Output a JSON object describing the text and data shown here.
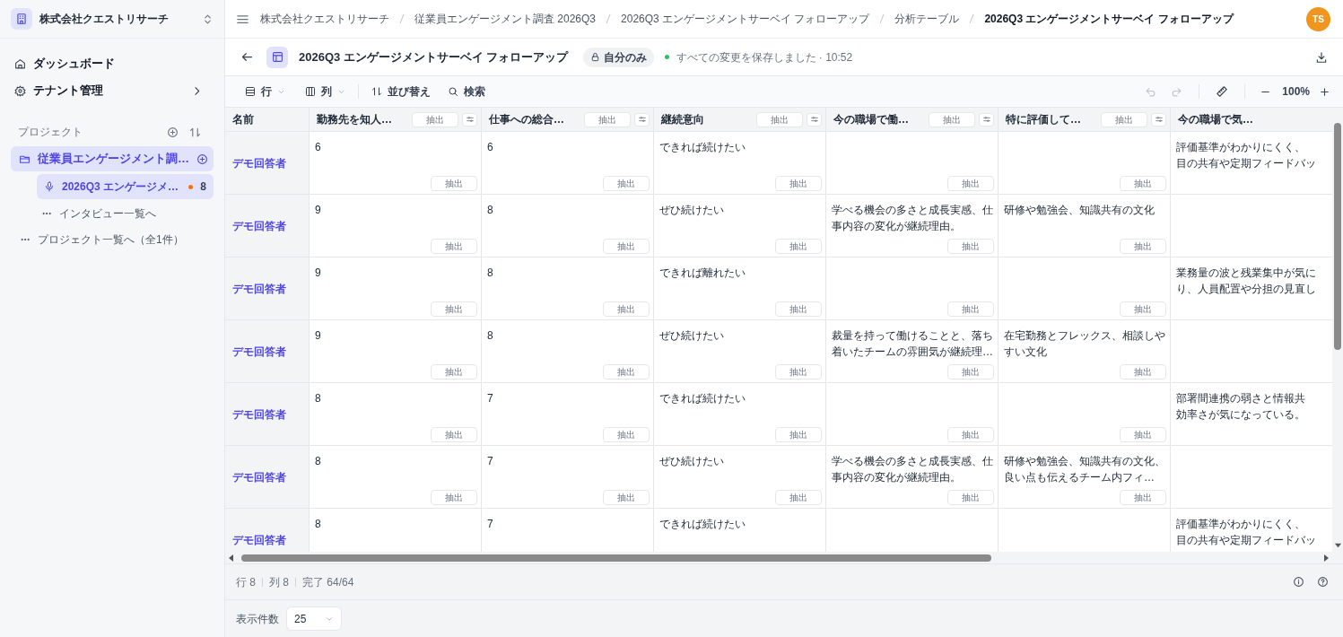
{
  "sidebar": {
    "org": "株式会社クエストリサーチ",
    "nav": [
      {
        "label": "ダッシュボード",
        "kind": "home",
        "has_submenu": false
      },
      {
        "label": "テナント管理",
        "kind": "settings",
        "has_submenu": true
      }
    ],
    "section_title": "プロジェクト",
    "projects": [
      {
        "label": "従業員エンゲージメント調…",
        "selected": true,
        "children": [
          {
            "label": "2026Q3 エンゲージメ…",
            "selected": true,
            "badge": "8"
          }
        ],
        "more_link": "インタビュー一覧へ"
      }
    ],
    "all_projects_link": "プロジェクト一覧へ（全1件）"
  },
  "breadcrumbs": [
    "株式会社クエストリサーチ",
    "従業員エンゲージメント調査 2026Q3",
    "2026Q3 エンゲージメントサーベイ フォローアップ",
    "分析テーブル",
    "2026Q3 エンゲージメントサーベイ フォローアップ"
  ],
  "avatar": "TS",
  "title_bar": {
    "title": "2026Q3 エンゲージメントサーベイ フォローアップ",
    "visibility": "自分のみ",
    "save_status": "すべての変更を保存しました · 10:52"
  },
  "toolbar": {
    "rows": "行",
    "columns": "列",
    "sort": "並び替え",
    "search": "検索",
    "zoom": "100%"
  },
  "table": {
    "name_header": "名前",
    "columns": [
      {
        "label": "勤務先を知人…",
        "action": "抽出"
      },
      {
        "label": "仕事への総合…",
        "action": "抽出"
      },
      {
        "label": "継続意向",
        "action": "抽出"
      },
      {
        "label": "今の職場で働…",
        "action": "抽出"
      },
      {
        "label": "特に評価して…",
        "action": "抽出"
      },
      {
        "label": "今の職場で気…"
      }
    ],
    "rows": [
      {
        "name": "デモ回答者",
        "cells": [
          {
            "text": "6",
            "action": "抽出"
          },
          {
            "text": "6",
            "action": "抽出"
          },
          {
            "text": "できれば続けたい",
            "action": "抽出"
          },
          {
            "action": "抽出"
          },
          {
            "action": "抽出"
          },
          {
            "lines": [
              "評価基準がわかりにくく、",
              "目の共有や定期フィードバッ"
            ]
          }
        ]
      },
      {
        "name": "デモ回答者",
        "cells": [
          {
            "text": "9",
            "action": "抽出"
          },
          {
            "text": "8",
            "action": "抽出"
          },
          {
            "text": "ぜひ続けたい",
            "action": "抽出"
          },
          {
            "text": "学べる機会の多さと成長実感、仕事内容の変化が継続理由。",
            "action": "抽出"
          },
          {
            "text": "研修や勉強会、知識共有の文化",
            "action": "抽出"
          },
          {}
        ]
      },
      {
        "name": "デモ回答者",
        "cells": [
          {
            "text": "9",
            "action": "抽出"
          },
          {
            "text": "8",
            "action": "抽出"
          },
          {
            "text": "できれば離れたい",
            "action": "抽出"
          },
          {
            "action": "抽出"
          },
          {
            "action": "抽出"
          },
          {
            "lines": [
              "業務量の波と残業集中が気に",
              "り、人員配置や分担の見直し"
            ]
          }
        ]
      },
      {
        "name": "デモ回答者",
        "cells": [
          {
            "text": "9",
            "action": "抽出"
          },
          {
            "text": "8",
            "action": "抽出"
          },
          {
            "text": "ぜひ続けたい",
            "action": "抽出"
          },
          {
            "text": "裁量を持って働けることと、落ち着いたチームの雰囲気が継続理…",
            "action": "抽出"
          },
          {
            "text": "在宅勤務とフレックス、相談しやすい文化",
            "action": "抽出"
          },
          {}
        ]
      },
      {
        "name": "デモ回答者",
        "cells": [
          {
            "text": "8",
            "action": "抽出"
          },
          {
            "text": "7",
            "action": "抽出"
          },
          {
            "text": "できれば続けたい",
            "action": "抽出"
          },
          {
            "action": "抽出"
          },
          {
            "action": "抽出"
          },
          {
            "lines": [
              "部署間連携の弱さと情報共",
              "効率さが気になっている。"
            ]
          }
        ]
      },
      {
        "name": "デモ回答者",
        "cells": [
          {
            "text": "8",
            "action": "抽出"
          },
          {
            "text": "7",
            "action": "抽出"
          },
          {
            "text": "ぜひ続けたい",
            "action": "抽出"
          },
          {
            "text": "学べる機会の多さと成長実感、仕事内容の変化が継続理由。",
            "action": "抽出"
          },
          {
            "text": "研修や勉強会、知識共有の文化、良い点も伝えるチーム内フィ…",
            "action": "抽出"
          },
          {}
        ]
      },
      {
        "name": "デモ回答者",
        "cells": [
          {
            "text": "8"
          },
          {
            "text": "7"
          },
          {
            "text": "できれば続けたい"
          },
          {},
          {},
          {
            "lines": [
              "評価基準がわかりにくく、",
              "目の共有や定期フィードバッ"
            ]
          }
        ]
      }
    ]
  },
  "status_bar": [
    "行 8",
    "列 8",
    "完了 64/64"
  ],
  "footer": {
    "label": "表示件数",
    "page_size": "25"
  }
}
